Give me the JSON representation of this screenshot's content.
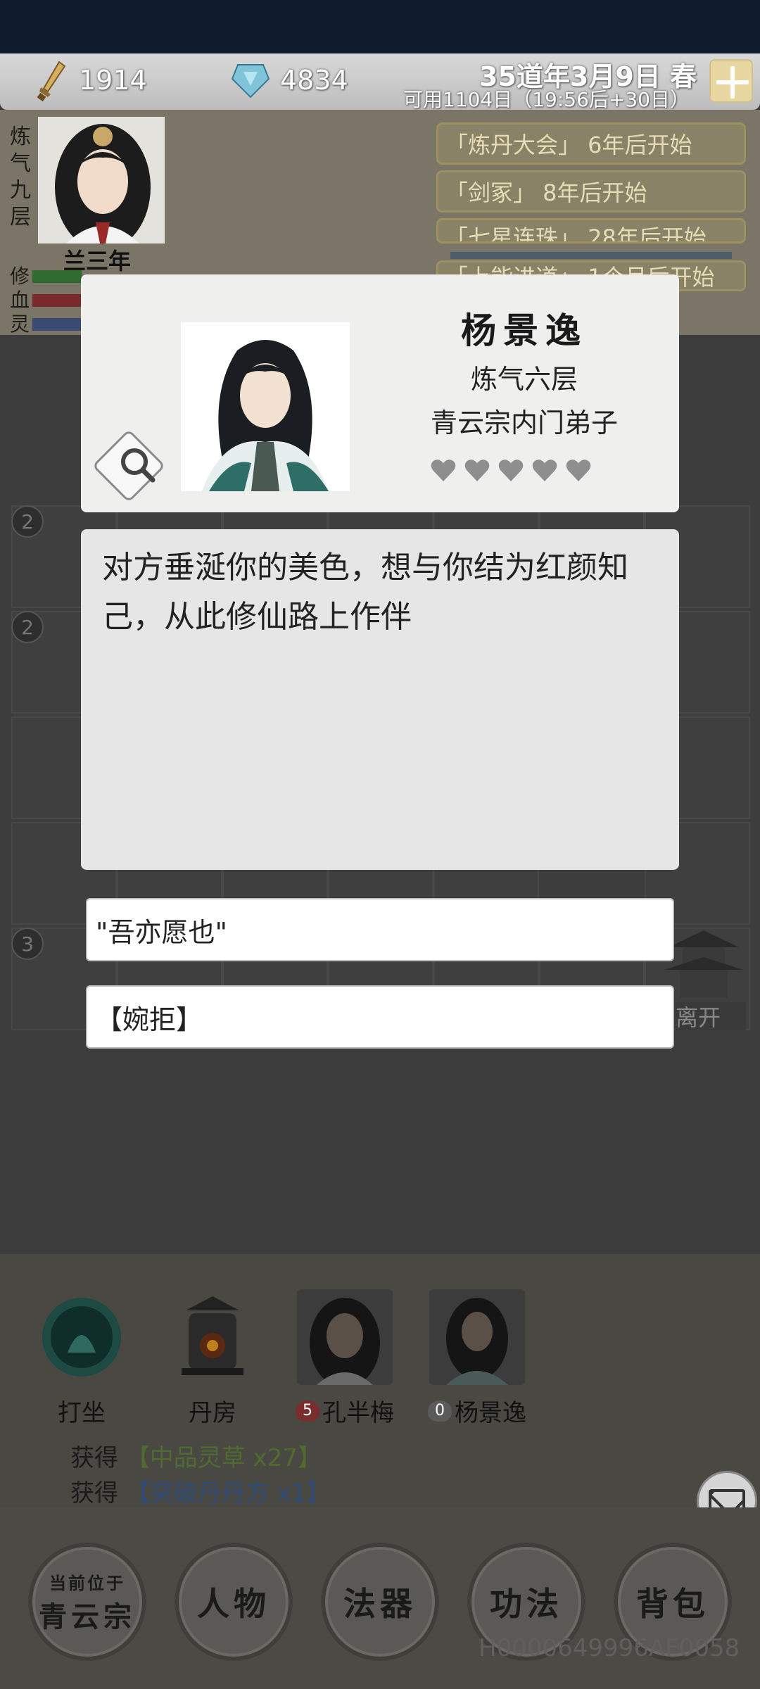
{
  "topbar": {
    "stones": "1914",
    "crystals": "4834",
    "date": "35道年3月9日 春",
    "available": "可用1104日（19:56后+30日）"
  },
  "player": {
    "realm_vertical": "炼气九层",
    "name": "兰三年",
    "stat_labels": [
      "修",
      "血",
      "灵"
    ],
    "stat_colors": [
      "#2f7a2f",
      "#8a2a2a",
      "#3a4a7a"
    ]
  },
  "events": [
    "「炼丹大会」 6年后开始",
    "「剑冢」 8年后开始",
    "「七星连珠」 28年后开始",
    "「上能进道」 1个月后开始"
  ],
  "grid": {
    "row_badges": [
      "2",
      "2",
      "3"
    ],
    "leave_label": "离开"
  },
  "dialog": {
    "npc_name": "杨景逸",
    "npc_realm": "炼气六层",
    "npc_sect": "青云宗内门弟子",
    "hearts": 5,
    "message": "对方垂涎你的美色，想与你结为红颜知己，从此修仙路上作伴",
    "choice_accept": "\"吾亦愿也\"",
    "choice_reject": "【婉拒】"
  },
  "bottom": {
    "icons": [
      {
        "label": "打坐"
      },
      {
        "label": "丹房"
      },
      {
        "label": "孔半梅",
        "badge": "5"
      },
      {
        "label": "杨景逸",
        "badge": "0"
      }
    ],
    "log": [
      {
        "prefix": "获得",
        "item": "【中品灵草 x27】"
      },
      {
        "prefix": "获得",
        "item": "【突破丹丹方 x1】"
      }
    ]
  },
  "nav": {
    "location_caption": "当前位于",
    "location": "青云宗",
    "character": "人物",
    "artifact": "法器",
    "technique": "功法",
    "bag": "背包"
  },
  "device_id": "H0000649996AF0058"
}
